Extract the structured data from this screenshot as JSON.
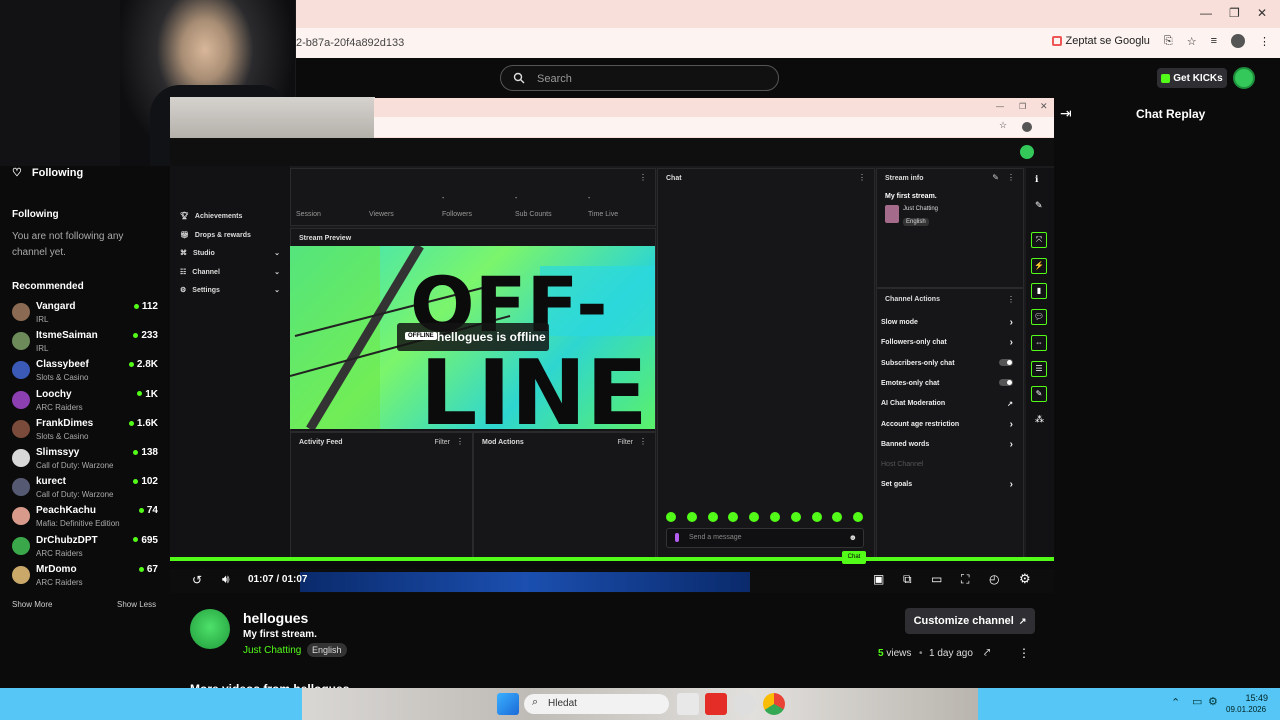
{
  "browser": {
    "url_fragment": "2-b87a-20f4a892d133",
    "ask_google": "Zeptat se Googlu",
    "window_controls": [
      "—",
      "❐",
      "✕"
    ]
  },
  "topnav": {
    "search_placeholder": "Search",
    "get_kicks": "Get KICKs"
  },
  "sidebar": {
    "following_nav": "Following",
    "following_heading": "Following",
    "following_empty": "You are not following any channel yet.",
    "recommended_heading": "Recommended",
    "channels": [
      {
        "name": "Vangard",
        "category": "IRL",
        "viewers": "112",
        "avatar_color": "#8a6a52"
      },
      {
        "name": "ItsmeSaiman",
        "category": "IRL",
        "viewers": "233",
        "avatar_color": "#6d8a5a"
      },
      {
        "name": "Classybeef",
        "category": "Slots & Casino",
        "viewers": "2.8K",
        "avatar_color": "#3b5ab8"
      },
      {
        "name": "Loochy",
        "category": "ARC Raiders",
        "viewers": "1K",
        "avatar_color": "#8c3fb0"
      },
      {
        "name": "FrankDimes",
        "category": "Slots & Casino",
        "viewers": "1.6K",
        "avatar_color": "#7a4b3a"
      },
      {
        "name": "Slimssyy",
        "category": "Call of Duty: Warzone",
        "viewers": "138",
        "avatar_color": "#d8d8d8"
      },
      {
        "name": "kurect",
        "category": "Call of Duty: Warzone",
        "viewers": "102",
        "avatar_color": "#555a72"
      },
      {
        "name": "PeachKachu",
        "category": "Mafia: Definitive Edition",
        "viewers": "74",
        "avatar_color": "#d89a8a"
      },
      {
        "name": "DrChubzDPT",
        "category": "ARC Raiders",
        "viewers": "695",
        "avatar_color": "#3aa84a"
      },
      {
        "name": "MrDomo",
        "category": "ARC Raiders",
        "viewers": "67",
        "avatar_color": "#c9a86a"
      }
    ],
    "show_more": "Show More",
    "show_less": "Show Less"
  },
  "dashboard": {
    "menu": [
      "Achievements",
      "Drops & rewards",
      "Studio",
      "Channel",
      "Settings"
    ],
    "stats": [
      {
        "value": "",
        "label": "Session"
      },
      {
        "value": "",
        "label": "Viewers"
      },
      {
        "value": "-",
        "label": "Followers"
      },
      {
        "value": "-",
        "label": "Sub Counts"
      },
      {
        "value": "-",
        "label": "Time Live"
      }
    ],
    "stream_preview": "Stream Preview",
    "offline_badge": "OFFLINE",
    "offline_text": "hellogues is offline",
    "offline_art": "OFF-LINE",
    "activity_feed": "Activity Feed",
    "mod_actions": "Mod Actions",
    "filter": "Filter",
    "chat": "Chat",
    "send_message": "Send a message",
    "chat_button": "Chat",
    "stream_info": "Stream info",
    "stream_title": "My first stream.",
    "stream_category": "Just Chatting",
    "stream_lang": "English",
    "channel_actions": "Channel Actions",
    "actions": [
      {
        "label": "Slow mode",
        "control": "arrow"
      },
      {
        "label": "Followers-only chat",
        "control": "arrow"
      },
      {
        "label": "Subscribers-only chat",
        "control": "toggle"
      },
      {
        "label": "Emotes-only chat",
        "control": "toggle"
      },
      {
        "label": "AI Chat Moderation",
        "control": "external"
      },
      {
        "label": "Account age restriction",
        "control": "arrow"
      },
      {
        "label": "Banned words",
        "control": "arrow"
      },
      {
        "label": "Host Channel",
        "control": "none"
      },
      {
        "label": "Set goals",
        "control": "arrow"
      }
    ]
  },
  "player": {
    "time": "01:07 / 01:07",
    "progress": 1.0
  },
  "video": {
    "channel": "hellogues",
    "title": "My first stream.",
    "category": "Just Chatting",
    "language": "English",
    "customize": "Customize channel",
    "views_count": "5",
    "views_label": "views",
    "age": "1 day ago",
    "more_videos": "More videos from hellogues"
  },
  "chat_replay": {
    "title": "Chat Replay"
  },
  "os_taskbar": {
    "search": "Hledat",
    "time": "15:49",
    "date": "09.01.2026"
  },
  "colors": {
    "accent": "#53fc18",
    "taskbar": "#55c6f5",
    "browser_tab": "#f9dfd9"
  }
}
